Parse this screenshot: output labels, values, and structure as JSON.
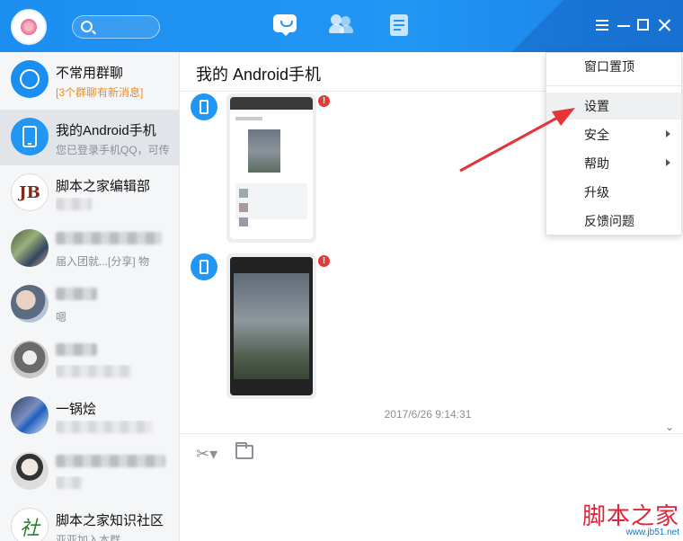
{
  "chat": {
    "title": "我的 Android手机",
    "timestamp": "2017/6/26 9:14:31"
  },
  "sidebar": {
    "items": [
      {
        "name": "不常用群聊",
        "subtitle": "[3个群聊有新消息]"
      },
      {
        "name": "我的Android手机",
        "subtitle": "您已登录手机QQ，可传"
      },
      {
        "name": "脚本之家编辑部",
        "subtitle": ""
      },
      {
        "name": "",
        "subtitle": "届入团就...[分享] 物"
      },
      {
        "name": "",
        "subtitle": "嗯"
      },
      {
        "name": "",
        "subtitle": ""
      },
      {
        "name": "一锅烩",
        "subtitle": ""
      },
      {
        "name": "",
        "subtitle": ""
      },
      {
        "name": "脚本之家知识社区",
        "subtitle": "亚亚加入本群。"
      }
    ]
  },
  "menu": {
    "items": [
      "窗口置顶",
      "设置",
      "安全",
      "帮助",
      "升级",
      "反馈问题"
    ]
  },
  "watermark": {
    "cn": "脚本之家",
    "url": "www.jb51.net"
  },
  "colors": {
    "accent": "#1c8ef0",
    "annotation_arrow": "#e5333a"
  }
}
